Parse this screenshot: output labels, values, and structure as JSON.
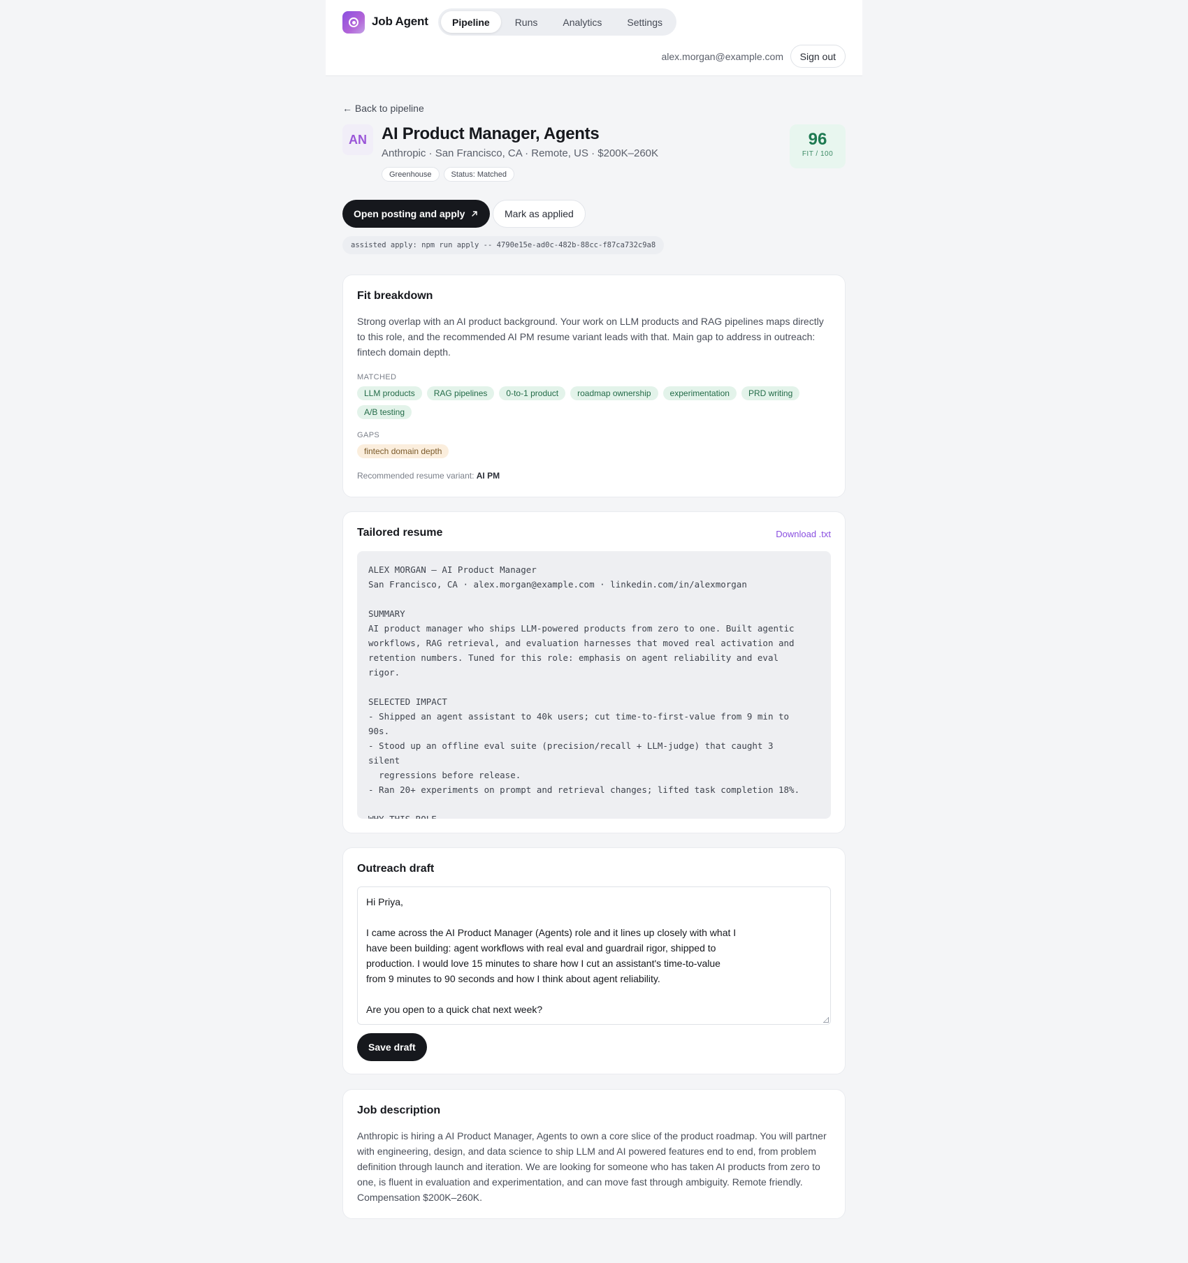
{
  "header": {
    "brand": "Job Agent",
    "nav_tabs": [
      {
        "label": "Pipeline",
        "active": true
      },
      {
        "label": "Runs",
        "active": false
      },
      {
        "label": "Analytics",
        "active": false
      },
      {
        "label": "Settings",
        "active": false
      }
    ],
    "user_email": "alex.morgan@example.com",
    "sign_out_label": "Sign out"
  },
  "job": {
    "back_label": "← Back to pipeline",
    "avatar_initials": "AN",
    "title": "AI Product Manager, Agents",
    "meta": "Anthropic · San Francisco, CA · Remote, US · $200K–260K",
    "chips": [
      "Greenhouse",
      "Status: Matched"
    ],
    "fit_score": "96",
    "fit_score_label": "FIT / 100",
    "apply_label": "Open posting and apply",
    "apply_icon": "arrow-up-right-icon",
    "mark_applied_label": "Mark as applied",
    "assisted_command": "assisted apply: npm run apply -- 4790e15e-ad0c-482b-88cc-f87ca732c9a8"
  },
  "fit": {
    "title": "Fit breakdown",
    "summary": "Strong overlap with an AI product background. Your work on LLM products and RAG pipelines maps directly to this role, and the recommended AI PM resume variant leads with that. Main gap to address in outreach: fintech domain depth.",
    "matched_label": "MATCHED",
    "matched": [
      "LLM products",
      "RAG pipelines",
      "0-to-1 product",
      "roadmap ownership",
      "experimentation",
      "PRD writing",
      "A/B testing"
    ],
    "gaps_label": "GAPS",
    "gaps": [
      "fintech domain depth"
    ],
    "variant_label": "Recommended resume variant:",
    "variant_value": "AI PM"
  },
  "resume": {
    "title": "Tailored resume",
    "download_label": "Download .txt",
    "text": "ALEX MORGAN — AI Product Manager\nSan Francisco, CA · alex.morgan@example.com · linkedin.com/in/alexmorgan\n\nSUMMARY\nAI product manager who ships LLM-powered products from zero to one. Built agentic\nworkflows, RAG retrieval, and evaluation harnesses that moved real activation and\nretention numbers. Tuned for this role: emphasis on agent reliability and eval\nrigor.\n\nSELECTED IMPACT\n- Shipped an agent assistant to 40k users; cut time-to-first-value from 9 min to\n90s.\n- Stood up an offline eval suite (precision/recall + LLM-judge) that caught 3\nsilent\n  regressions before release.\n- Ran 20+ experiments on prompt and retrieval changes; lifted task completion 18%.\n\nWHY THIS ROLE"
  },
  "outreach": {
    "title": "Outreach draft",
    "text": "Hi Priya,\n\nI came across the AI Product Manager (Agents) role and it lines up closely with what I have been building: agent workflows with real eval and guardrail rigor, shipped to production. I would love 15 minutes to share how I cut an assistant's time-to-value from 9 minutes to 90 seconds and how I think about agent reliability.\n\nAre you open to a quick chat next week?",
    "save_label": "Save draft"
  },
  "description": {
    "title": "Job description",
    "text": "Anthropic is hiring a AI Product Manager, Agents to own a core slice of the product roadmap. You will partner with engineering, design, and data science to ship LLM and AI powered features end to end, from problem definition through launch and iteration. We are looking for someone who has taken AI products from zero to one, is fluent in evaluation and experimentation, and can move fast through ambiguity. Remote friendly. Compensation $200K–260K."
  }
}
